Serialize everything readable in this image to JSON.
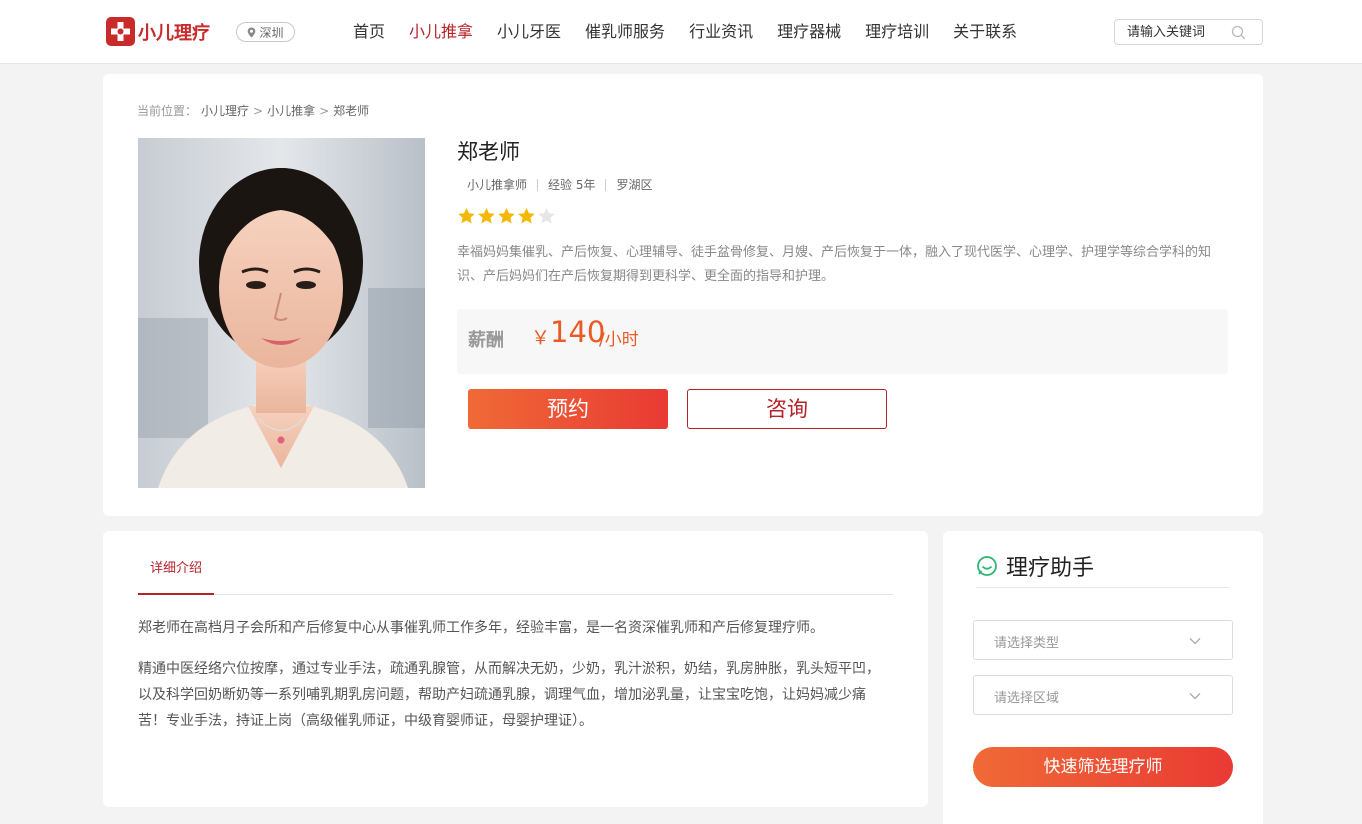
{
  "header": {
    "logo_text": "小儿理疗",
    "city": "深圳",
    "nav": [
      {
        "label": "首页",
        "active": false
      },
      {
        "label": "小儿推拿",
        "active": true
      },
      {
        "label": "小儿牙医",
        "active": false
      },
      {
        "label": "催乳师服务",
        "active": false
      },
      {
        "label": "行业资讯",
        "active": false
      },
      {
        "label": "理疗器械",
        "active": false
      },
      {
        "label": "理疗培训",
        "active": false
      },
      {
        "label": "关于联系",
        "active": false
      }
    ],
    "search_placeholder": "请输入关键词"
  },
  "breadcrumb": {
    "prefix": "当前位置：",
    "items": [
      "小儿理疗",
      "小儿推拿",
      "郑老师"
    ],
    "separator": ">"
  },
  "profile": {
    "name": "郑老师",
    "tags": [
      "小儿推拿师",
      "经验 5年",
      "罗湖区"
    ],
    "rating": 4,
    "rating_max": 5,
    "description": "幸福妈妈集催乳、产后恢复、心理辅导、徒手盆骨修复、月嫂、产后恢复于一体，融入了现代医学、心理学、护理学等综合学科的知识、产后妈妈们在产后恢复期得到更科学、更全面的指导和护理。",
    "price_label": "薪酬",
    "price_currency": "￥",
    "price_amount": "140",
    "price_unit": "/小时",
    "book_label": "预约",
    "consult_label": "咨询"
  },
  "detail": {
    "tab_label": "详细介绍",
    "paragraphs": [
      "郑老师在高档月子会所和产后修复中心从事催乳师工作多年，经验丰富，是一名资深催乳师和产后修复理疗师。",
      "精通中医经络穴位按摩，通过专业手法，疏通乳腺管，从而解决无奶，少奶，乳汁淤积，奶结，乳房肿胀，乳头短平凹，以及科学回奶断奶等一系列哺乳期乳房问题，帮助产妇疏通乳腺，调理气血，增加泌乳量，让宝宝吃饱，让妈妈减少痛苦！专业手法，持证上岗（高级催乳师证，中级育婴师证，母婴护理证）。"
    ]
  },
  "assistant": {
    "title": "理疗助手",
    "select_type_placeholder": "请选择类型",
    "select_area_placeholder": "请选择区域",
    "filter_button": "快速筛选理疗师"
  },
  "colors": {
    "brand": "#b5222a",
    "accent_orange": "#ea5a24",
    "star": "#f5b800",
    "star_empty": "#e6e6e6",
    "assistant_icon": "#2bb673"
  },
  "icons": [
    "logo-icon",
    "location-pin-icon",
    "search-icon",
    "star-icon",
    "chat-bubble-icon",
    "chevron-down-icon"
  ]
}
